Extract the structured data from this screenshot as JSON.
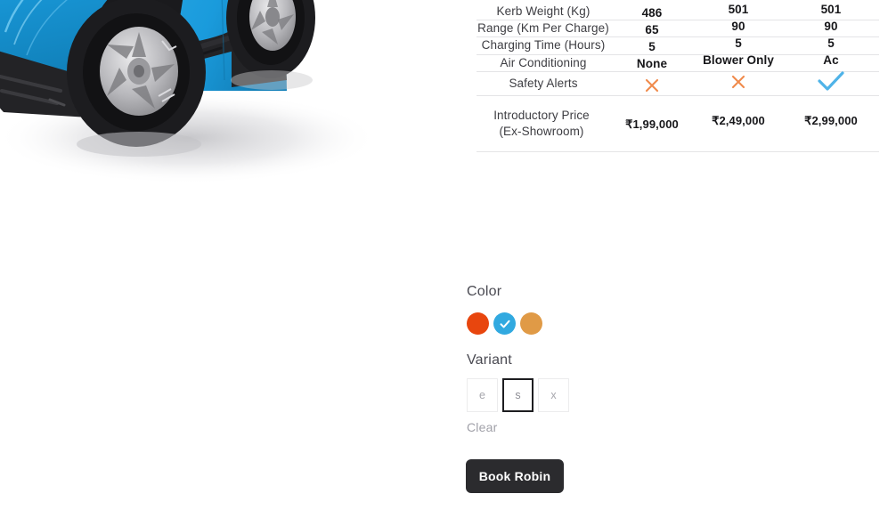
{
  "product": {
    "image_alt": "blue-compact-electric-car",
    "body_color": "#1a9bdc",
    "body_color_dark": "#0f7cb4",
    "body_color_light": "#4fc0f0",
    "trim_color": "#26262a",
    "shadow_color": "#d6d6d8"
  },
  "spec_table": {
    "rows": [
      {
        "label": "Kerb Weight (Kg)",
        "type": "text",
        "values": [
          "486",
          "501",
          "501"
        ]
      },
      {
        "label": "Range (Km Per Charge)",
        "type": "text",
        "values": [
          "65",
          "90",
          "90"
        ]
      },
      {
        "label": "Charging Time (Hours)",
        "type": "text",
        "values": [
          "5",
          "5",
          "5"
        ]
      },
      {
        "label": "Air Conditioning",
        "type": "text",
        "values": [
          "None",
          "Blower Only",
          "Ac"
        ]
      },
      {
        "label": "Safety Alerts",
        "type": "icon",
        "values": [
          "cross-icon",
          "cross-icon",
          "check-icon"
        ]
      },
      {
        "label": "Introductory Price (Ex-Showroom)",
        "label_line1": "Introductory Price",
        "label_line2": "(Ex-Showroom)",
        "type": "price",
        "values": [
          "₹1,99,000",
          "₹2,49,000",
          "₹2,99,000"
        ]
      }
    ]
  },
  "color_section": {
    "title": "Color",
    "swatches": [
      {
        "name": "orange-red",
        "hex": "#E8460E",
        "selected": false
      },
      {
        "name": "blue",
        "hex": "#31A9E0",
        "selected": true
      },
      {
        "name": "light-orange",
        "hex": "#E09A46",
        "selected": false
      }
    ]
  },
  "variant_section": {
    "title": "Variant",
    "options": [
      {
        "label": "e",
        "selected": false
      },
      {
        "label": "s",
        "selected": true
      },
      {
        "label": "x",
        "selected": false
      }
    ],
    "clear_label": "Clear"
  },
  "cta": {
    "book_label": "Book Robin"
  },
  "colors": {
    "accent_blue": "#31A9E0",
    "alert_orange": "#F08A4B",
    "check_blue": "#4FB3E8",
    "cta_background": "#2b2b2e",
    "divider": "#e4e4e6"
  }
}
